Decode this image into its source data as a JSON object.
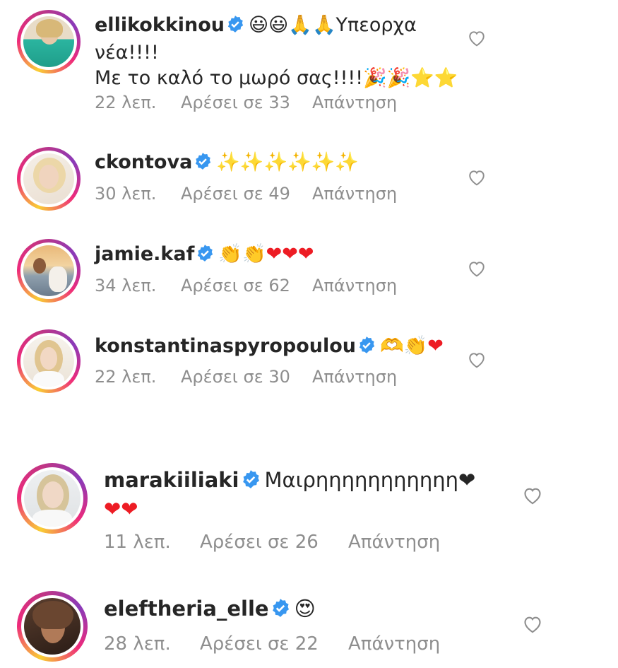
{
  "comments": [
    {
      "username": "ellikokkinou",
      "line1": "😃😃🙏🙏Υπεορχα",
      "line2": "νέα!!!!",
      "line3": "Με το καλό το μωρό σας!!!!🎉🎉⭐⭐",
      "time": "22 λεπ.",
      "likes": "Αρέσει σε 33",
      "reply": "Απάντηση",
      "avatar_colors": [
        "#e8dcc8",
        "#2bb5a0"
      ]
    },
    {
      "username": "ckontova",
      "line1": "✨✨✨✨✨✨",
      "time": "30 λεπ.",
      "likes": "Αρέσει σε 49",
      "reply": "Απάντηση",
      "avatar_colors": [
        "#f1e8e0",
        "#e4c9a8"
      ]
    },
    {
      "username": "jamie.kaf",
      "line1": "👏👏❤❤❤",
      "time": "34 λεπ.",
      "likes": "Αρέσει σε 62",
      "reply": "Απάντηση",
      "avatar_colors": [
        "#d9a86c",
        "#6b7b8c"
      ]
    },
    {
      "username": "konstantinaspyropoulou",
      "line1": "🫶👏❤",
      "time": "22 λεπ.",
      "likes": "Αρέσει σε 30",
      "reply": "Απάντηση",
      "avatar_colors": [
        "#f3efe9",
        "#d9c8a8"
      ]
    },
    {
      "username": "marakiiliaki",
      "line1": "Μαιρηηηηηηηηηηη❤",
      "line2": "❤❤",
      "time": "11 λεπ.",
      "likes": "Αρέσει σε 26",
      "reply": "Απάντηση",
      "avatar_colors": [
        "#e6e8ea",
        "#cfc2a6"
      ]
    },
    {
      "username": "eleftheria_elle",
      "line1": "😍",
      "time": "28 λεπ.",
      "likes": "Αρέσει σε 22",
      "reply": "Απάντηση",
      "avatar_colors": [
        "#3a2a22",
        "#8a5a3a"
      ]
    }
  ],
  "colors": {
    "text": "#262626",
    "meta": "#8e8e8e",
    "verified": "#3897f0",
    "heart_outline": "#8e8e8e",
    "emoji_heart": "#ed1c24"
  }
}
